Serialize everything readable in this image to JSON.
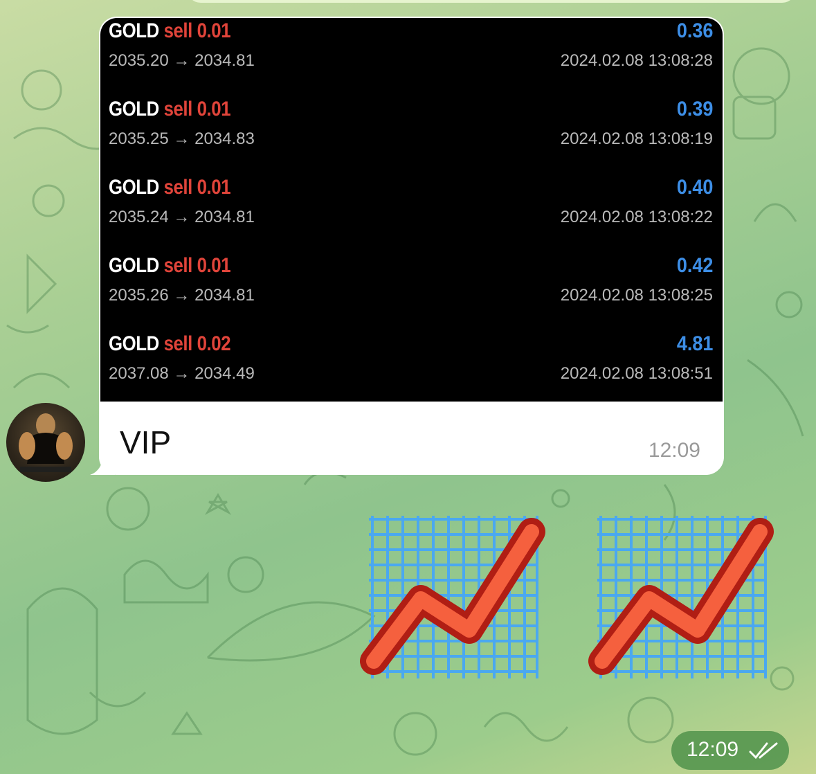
{
  "message": {
    "trades": [
      {
        "symbol": "GOLD",
        "side": "sell",
        "lot": "0.01",
        "profit": "0.36",
        "prices": "2035.20 → 2034.81",
        "time": "2024.02.08 13:08:28"
      },
      {
        "symbol": "GOLD",
        "side": "sell",
        "lot": "0.01",
        "profit": "0.39",
        "prices": "2035.25 → 2034.83",
        "time": "2024.02.08 13:08:19"
      },
      {
        "symbol": "GOLD",
        "side": "sell",
        "lot": "0.01",
        "profit": "0.40",
        "prices": "2035.24 → 2034.81",
        "time": "2024.02.08 13:08:22"
      },
      {
        "symbol": "GOLD",
        "side": "sell",
        "lot": "0.01",
        "profit": "0.42",
        "prices": "2035.26 → 2034.81",
        "time": "2024.02.08 13:08:25"
      },
      {
        "symbol": "GOLD",
        "side": "sell",
        "lot": "0.02",
        "profit": "4.81",
        "prices": "2037.08 → 2034.49",
        "time": "2024.02.08 13:08:51"
      }
    ],
    "caption": "VIP",
    "time": "12:09"
  },
  "emoji_message": {
    "emojis": [
      "chart-increasing-icon",
      "chart-increasing-icon"
    ],
    "time": "12:09",
    "status_icon": "double-check-icon"
  },
  "colors": {
    "sell": "#e0443a",
    "profit": "#3d8ee6",
    "screenshot_bg": "#000000",
    "bubble_bg": "#ffffff",
    "own_time_pill": "#5b9a53"
  }
}
